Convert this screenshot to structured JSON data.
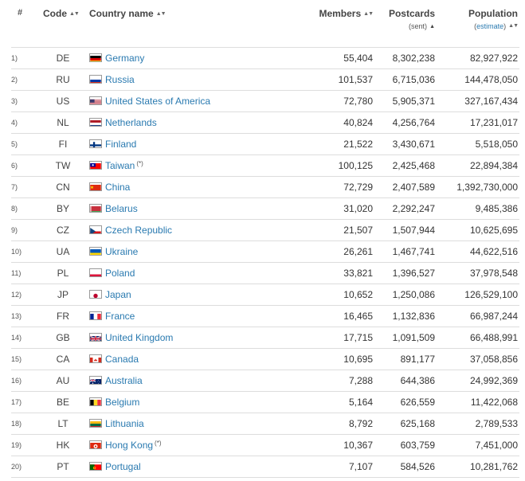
{
  "headers": {
    "index": "#",
    "code": "Code",
    "country": "Country name",
    "members": "Members",
    "postcards": "Postcards",
    "postcards_sub": "(sent)",
    "population": "Population",
    "population_sub": "(estimate)"
  },
  "taiwan_note": "(*)",
  "rows": [
    {
      "idx": "1)",
      "code": "DE",
      "country": "Germany",
      "members": "55,404",
      "postcards": "8,302,238",
      "population": "82,927,922",
      "flag": "de-flag-icon"
    },
    {
      "idx": "2)",
      "code": "RU",
      "country": "Russia",
      "members": "101,537",
      "postcards": "6,715,036",
      "population": "144,478,050",
      "flag": "ru-flag-icon"
    },
    {
      "idx": "3)",
      "code": "US",
      "country": "United States of America",
      "members": "72,780",
      "postcards": "5,905,371",
      "population": "327,167,434",
      "flag": "us-flag-icon"
    },
    {
      "idx": "4)",
      "code": "NL",
      "country": "Netherlands",
      "members": "40,824",
      "postcards": "4,256,764",
      "population": "17,231,017",
      "flag": "nl-flag-icon"
    },
    {
      "idx": "5)",
      "code": "FI",
      "country": "Finland",
      "members": "21,522",
      "postcards": "3,430,671",
      "population": "5,518,050",
      "flag": "fi-flag-icon"
    },
    {
      "idx": "6)",
      "code": "TW",
      "country": "Taiwan",
      "members": "100,125",
      "postcards": "2,425,468",
      "population": "22,894,384",
      "flag": "tw-flag-icon",
      "note": "(*)"
    },
    {
      "idx": "7)",
      "code": "CN",
      "country": "China",
      "members": "72,729",
      "postcards": "2,407,589",
      "population": "1,392,730,000",
      "flag": "cn-flag-icon"
    },
    {
      "idx": "8)",
      "code": "BY",
      "country": "Belarus",
      "members": "31,020",
      "postcards": "2,292,247",
      "population": "9,485,386",
      "flag": "by-flag-icon"
    },
    {
      "idx": "9)",
      "code": "CZ",
      "country": "Czech Republic",
      "members": "21,507",
      "postcards": "1,507,944",
      "population": "10,625,695",
      "flag": "cz-flag-icon"
    },
    {
      "idx": "10)",
      "code": "UA",
      "country": "Ukraine",
      "members": "26,261",
      "postcards": "1,467,741",
      "population": "44,622,516",
      "flag": "ua-flag-icon"
    },
    {
      "idx": "11)",
      "code": "PL",
      "country": "Poland",
      "members": "33,821",
      "postcards": "1,396,527",
      "population": "37,978,548",
      "flag": "pl-flag-icon"
    },
    {
      "idx": "12)",
      "code": "JP",
      "country": "Japan",
      "members": "10,652",
      "postcards": "1,250,086",
      "population": "126,529,100",
      "flag": "jp-flag-icon"
    },
    {
      "idx": "13)",
      "code": "FR",
      "country": "France",
      "members": "16,465",
      "postcards": "1,132,836",
      "population": "66,987,244",
      "flag": "fr-flag-icon"
    },
    {
      "idx": "14)",
      "code": "GB",
      "country": "United Kingdom",
      "members": "17,715",
      "postcards": "1,091,509",
      "population": "66,488,991",
      "flag": "gb-flag-icon"
    },
    {
      "idx": "15)",
      "code": "CA",
      "country": "Canada",
      "members": "10,695",
      "postcards": "891,177",
      "population": "37,058,856",
      "flag": "ca-flag-icon"
    },
    {
      "idx": "16)",
      "code": "AU",
      "country": "Australia",
      "members": "7,288",
      "postcards": "644,386",
      "population": "24,992,369",
      "flag": "au-flag-icon"
    },
    {
      "idx": "17)",
      "code": "BE",
      "country": "Belgium",
      "members": "5,164",
      "postcards": "626,559",
      "population": "11,422,068",
      "flag": "be-flag-icon"
    },
    {
      "idx": "18)",
      "code": "LT",
      "country": "Lithuania",
      "members": "8,792",
      "postcards": "625,168",
      "population": "2,789,533",
      "flag": "lt-flag-icon"
    },
    {
      "idx": "19)",
      "code": "HK",
      "country": "Hong Kong",
      "members": "10,367",
      "postcards": "603,759",
      "population": "7,451,000",
      "flag": "hk-flag-icon",
      "note": "(*)"
    },
    {
      "idx": "20)",
      "code": "PT",
      "country": "Portugal",
      "members": "7,107",
      "postcards": "584,526",
      "population": "10,281,762",
      "flag": "pt-flag-icon"
    }
  ]
}
